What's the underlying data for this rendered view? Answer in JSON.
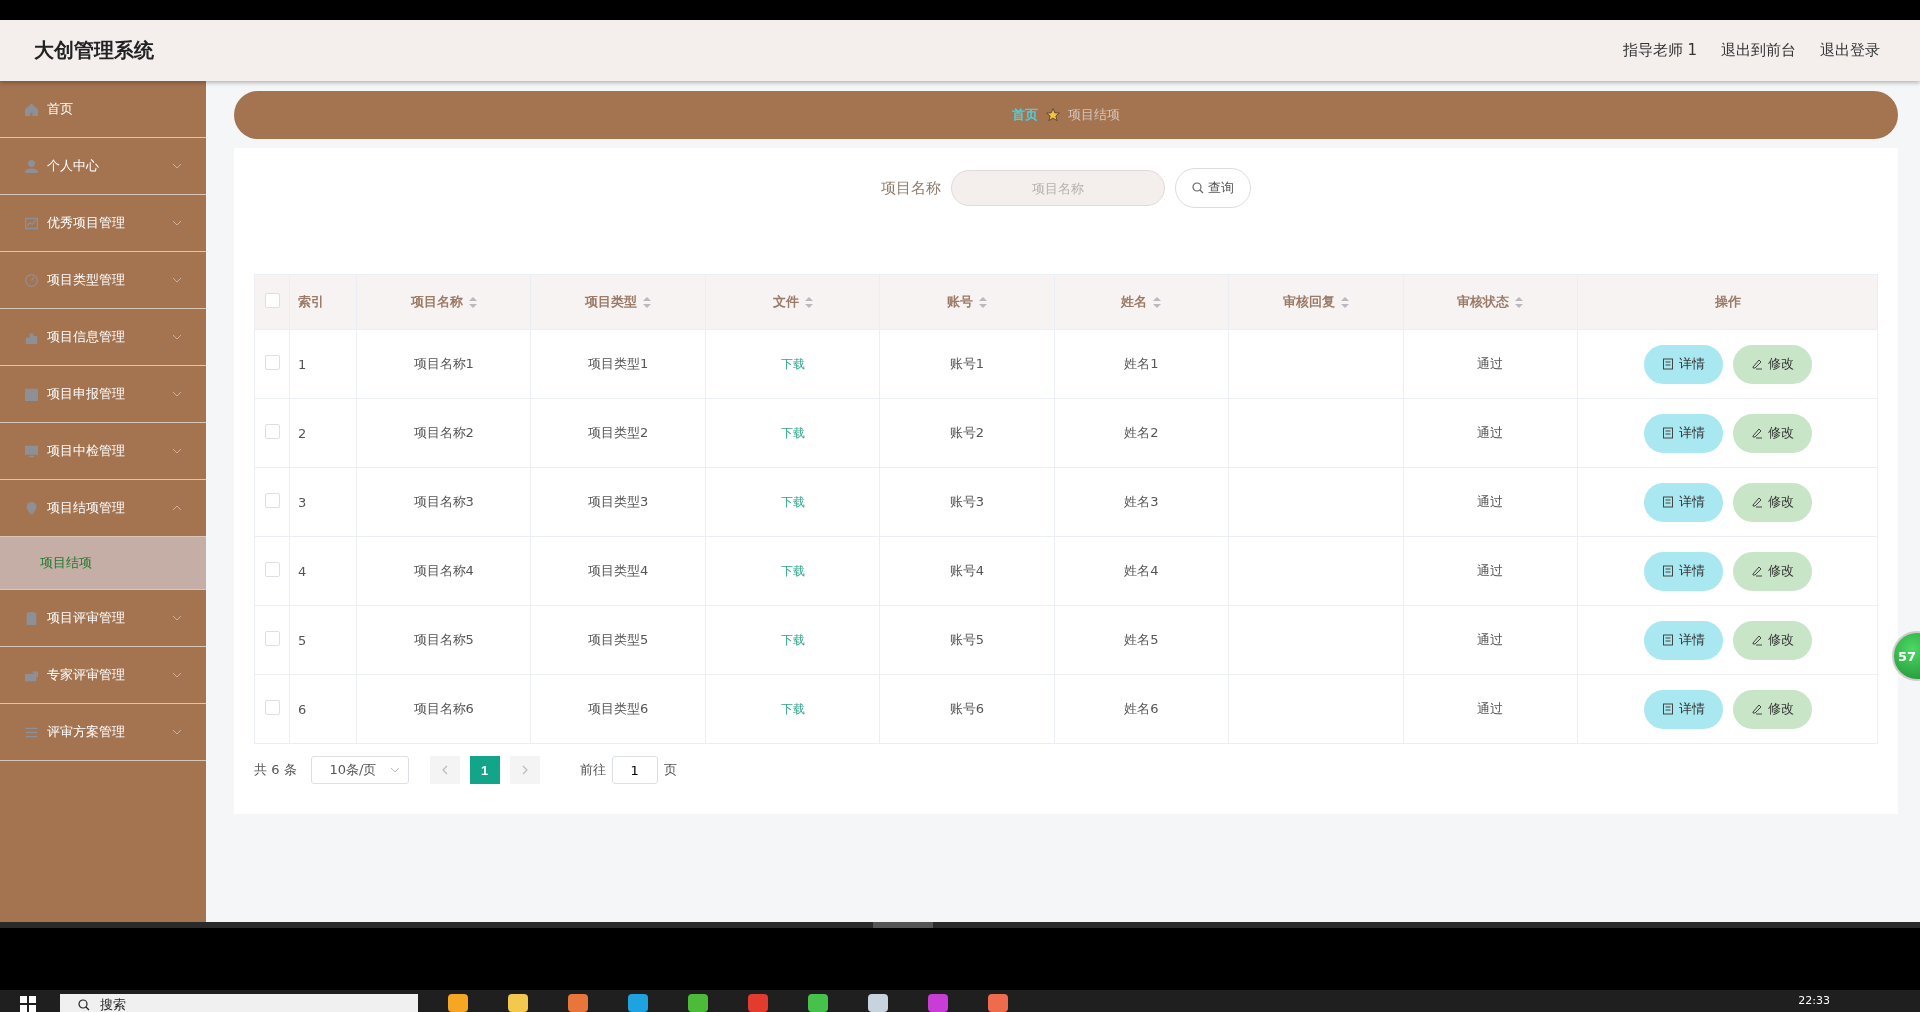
{
  "header": {
    "title": "大创管理系统",
    "links": [
      "指导老师 1",
      "退出到前台",
      "退出登录"
    ]
  },
  "sidebar": {
    "items": [
      {
        "label": "首页",
        "kind": "link"
      },
      {
        "label": "个人中心",
        "kind": "group",
        "expanded": false
      },
      {
        "label": "优秀项目管理",
        "kind": "group",
        "expanded": false
      },
      {
        "label": "项目类型管理",
        "kind": "group",
        "expanded": false
      },
      {
        "label": "项目信息管理",
        "kind": "group",
        "expanded": false
      },
      {
        "label": "项目申报管理",
        "kind": "group",
        "expanded": false
      },
      {
        "label": "项目中检管理",
        "kind": "group",
        "expanded": false
      },
      {
        "label": "项目结项管理",
        "kind": "group",
        "expanded": true,
        "children": [
          {
            "label": "项目结项",
            "selected": true
          }
        ]
      },
      {
        "label": "项目评审管理",
        "kind": "group",
        "expanded": false
      },
      {
        "label": "专家评审管理",
        "kind": "group",
        "expanded": false
      },
      {
        "label": "评审方案管理",
        "kind": "group",
        "expanded": false
      }
    ]
  },
  "breadcrumb": [
    "首页",
    "项目结项"
  ],
  "search": {
    "label": "项目名称",
    "placeholder": "项目名称",
    "button": "查询"
  },
  "table": {
    "select_all_checked": false,
    "columns": [
      {
        "label": "索引",
        "sortable": false
      },
      {
        "label": "项目名称",
        "sortable": true
      },
      {
        "label": "项目类型",
        "sortable": true
      },
      {
        "label": "文件",
        "sortable": true
      },
      {
        "label": "账号",
        "sortable": true
      },
      {
        "label": "姓名",
        "sortable": true
      },
      {
        "label": "审核回复",
        "sortable": true
      },
      {
        "label": "审核状态",
        "sortable": true
      },
      {
        "label": "操作",
        "sortable": false
      }
    ],
    "rows": [
      {
        "checked": false,
        "index": "1",
        "name": "项目名称1",
        "type": "项目类型1",
        "file": "下载",
        "account": "账号1",
        "person": "姓名1",
        "status": "通过",
        "actions": [
          "详情",
          "修改"
        ]
      },
      {
        "checked": false,
        "index": "2",
        "name": "项目名称2",
        "type": "项目类型2",
        "file": "下载",
        "account": "账号2",
        "person": "姓名2",
        "status": "通过",
        "actions": [
          "详情",
          "修改"
        ]
      },
      {
        "checked": false,
        "index": "3",
        "name": "项目名称3",
        "type": "项目类型3",
        "file": "下载",
        "account": "账号3",
        "person": "姓名3",
        "status": "通过",
        "actions": [
          "详情",
          "修改"
        ]
      },
      {
        "checked": false,
        "index": "4",
        "name": "项目名称4",
        "type": "项目类型4",
        "file": "下载",
        "account": "账号4",
        "person": "姓名4",
        "status": "通过",
        "actions": [
          "详情",
          "修改"
        ]
      },
      {
        "checked": false,
        "index": "5",
        "name": "项目名称5",
        "type": "项目类型5",
        "file": "下载",
        "account": "账号5",
        "person": "姓名5",
        "status": "通过",
        "actions": [
          "详情",
          "修改"
        ]
      },
      {
        "checked": false,
        "index": "6",
        "name": "项目名称6",
        "type": "项目类型6",
        "file": "下载",
        "account": "账号6",
        "person": "姓名6",
        "status": "通过",
        "actions": [
          "详情",
          "修改"
        ]
      }
    ]
  },
  "pagination": {
    "total": "共 6 条",
    "page_size": "10条/页",
    "pages": [
      {
        "label": "1",
        "selected": true
      }
    ],
    "goto_label": "前往",
    "goto_value": "1",
    "goto_suffix": "页"
  },
  "floating_badge": "57",
  "taskbar": {
    "search_placeholder": "搜索",
    "time": "22:33"
  }
}
